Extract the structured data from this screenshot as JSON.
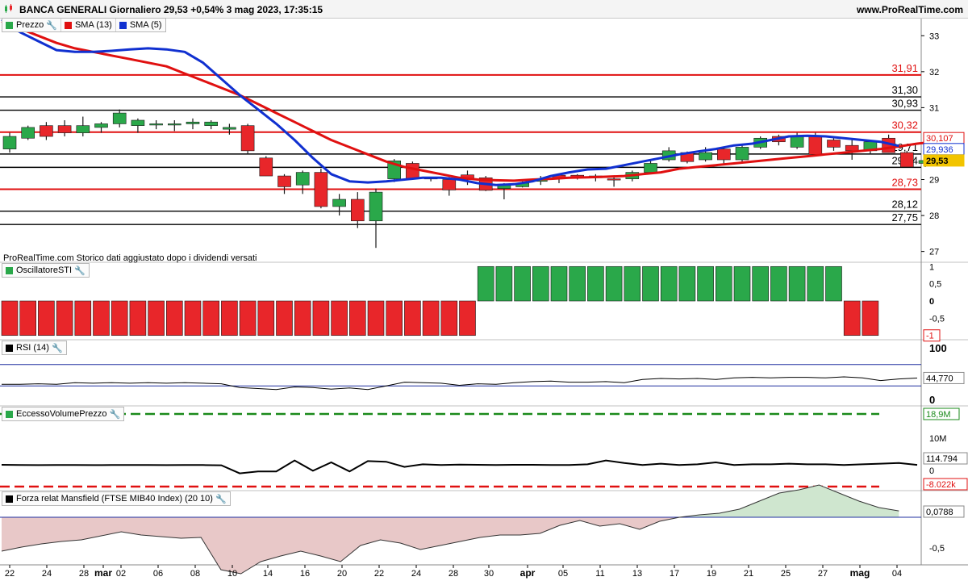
{
  "header": {
    "title": "BANCA GENERALI Giornaliero 29,53 +0,54% 3 mag 2023, 17:35:15",
    "site": "www.ProRealTime.com"
  },
  "note": "ProRealTime.com Storico dati aggiustato dopo i dividendi versati",
  "legends": {
    "price": [
      {
        "label": "Prezzo",
        "color": "#2aa84a",
        "icon": "candles-icon"
      },
      {
        "label": "SMA (13)",
        "color": "#e01010",
        "icon": "sma-icon"
      },
      {
        "label": "SMA (5)",
        "color": "#1030d0",
        "icon": "sma-icon"
      }
    ],
    "sti": "OscillatoreSTI",
    "rsi": "RSI (14)",
    "volume": "EccessoVolumePrezzo",
    "mansfield": "Forza relat Mansfield (FTSE MIB40 Index) (20 10)"
  },
  "colors": {
    "up": "#2aa84a",
    "down": "#e8262a",
    "sma13": "#e01010",
    "sma5": "#1030d0",
    "lastPrice": "#f2c400"
  },
  "chart_data": [
    {
      "type": "candlestick",
      "title": "BANCA GENERALI Giornaliero",
      "x_ticks": [
        "22",
        "24",
        "28",
        "mar",
        "02",
        "06",
        "08",
        "10",
        "14",
        "16",
        "20",
        "22",
        "24",
        "28",
        "30",
        "apr",
        "05",
        "11",
        "13",
        "17",
        "19",
        "21",
        "25",
        "27",
        "mag",
        "04"
      ],
      "y_ticks": [
        "27",
        "28",
        "29",
        "30",
        "31",
        "32",
        "33"
      ],
      "ylim": [
        26.7,
        33.5
      ],
      "ohlc": [
        [
          29.85,
          30.3,
          29.75,
          30.2
        ],
        [
          30.15,
          30.5,
          30.1,
          30.45
        ],
        [
          30.5,
          30.6,
          30.1,
          30.2
        ],
        [
          30.5,
          30.65,
          30.2,
          30.3
        ],
        [
          30.3,
          30.75,
          30.2,
          30.5
        ],
        [
          30.45,
          30.6,
          30.3,
          30.55
        ],
        [
          30.55,
          30.95,
          30.45,
          30.85
        ],
        [
          30.5,
          30.7,
          30.3,
          30.65
        ],
        [
          30.55,
          30.65,
          30.4,
          30.55
        ],
        [
          30.55,
          30.65,
          30.35,
          30.55
        ],
        [
          30.55,
          30.7,
          30.4,
          30.6
        ],
        [
          30.5,
          30.65,
          30.4,
          30.6
        ],
        [
          30.4,
          30.55,
          30.25,
          30.45
        ],
        [
          30.5,
          30.55,
          29.7,
          29.8
        ],
        [
          29.6,
          29.65,
          29.1,
          29.1
        ],
        [
          29.1,
          29.15,
          28.6,
          28.8
        ],
        [
          28.85,
          29.25,
          28.6,
          29.2
        ],
        [
          29.2,
          29.3,
          28.2,
          28.25
        ],
        [
          28.25,
          28.6,
          28.0,
          28.45
        ],
        [
          28.45,
          28.65,
          27.65,
          27.85
        ],
        [
          27.85,
          28.75,
          27.1,
          28.65
        ],
        [
          29.02,
          29.57,
          28.93,
          29.52
        ],
        [
          29.45,
          29.5,
          29.0,
          29.02
        ],
        [
          29.02,
          29.07,
          28.95,
          29.05
        ],
        [
          29.0,
          29.07,
          28.55,
          28.71
        ],
        [
          29.13,
          29.25,
          28.85,
          29.0
        ],
        [
          29.05,
          29.1,
          28.68,
          28.7
        ],
        [
          28.75,
          28.9,
          28.45,
          28.85
        ],
        [
          28.8,
          28.95,
          28.78,
          28.9
        ],
        [
          28.95,
          29.1,
          28.85,
          29.0
        ],
        [
          29.12,
          29.15,
          28.9,
          29.05
        ],
        [
          29.12,
          29.15,
          29.0,
          29.05
        ],
        [
          29.1,
          29.15,
          28.95,
          29.05
        ],
        [
          29.02,
          29.07,
          28.8,
          29.0
        ],
        [
          29.02,
          29.25,
          28.95,
          29.2
        ],
        [
          29.2,
          29.55,
          29.15,
          29.45
        ],
        [
          29.55,
          29.9,
          29.5,
          29.8
        ],
        [
          29.75,
          29.78,
          29.45,
          29.5
        ],
        [
          29.55,
          29.9,
          29.5,
          29.75
        ],
        [
          29.85,
          29.9,
          29.4,
          29.55
        ],
        [
          29.55,
          29.95,
          29.5,
          29.9
        ],
        [
          29.9,
          30.2,
          29.85,
          30.15
        ],
        [
          30.2,
          30.25,
          29.95,
          30.05
        ],
        [
          29.9,
          30.3,
          29.85,
          30.2
        ],
        [
          30.2,
          30.3,
          29.65,
          29.7
        ],
        [
          30.1,
          30.2,
          29.8,
          29.9
        ],
        [
          29.95,
          30.1,
          29.55,
          29.8
        ],
        [
          29.8,
          30.1,
          29.7,
          30.05
        ],
        [
          30.15,
          30.25,
          29.75,
          29.75
        ],
        [
          29.75,
          29.8,
          29.4,
          29.35
        ],
        [
          29.45,
          29.6,
          29.35,
          29.53
        ]
      ],
      "series": [
        {
          "name": "SMA (13)",
          "values": [
            33.4,
            33.2,
            33.0,
            32.8,
            32.65,
            32.55,
            32.45,
            32.35,
            32.25,
            32.15,
            31.95,
            31.75,
            31.55,
            31.35,
            31.1,
            30.85,
            30.6,
            30.35,
            30.1,
            29.9,
            29.7,
            29.5,
            29.35,
            29.25,
            29.15,
            29.05,
            29.0,
            28.98,
            28.97,
            29.0,
            29.02,
            29.05,
            29.06,
            29.08,
            29.1,
            29.15,
            29.2,
            29.3,
            29.35,
            29.4,
            29.45,
            29.5,
            29.55,
            29.6,
            29.65,
            29.7,
            29.75,
            29.8,
            29.85,
            29.92,
            30.0,
            30.05,
            30.107
          ]
        },
        {
          "name": "SMA (5)",
          "values": [
            33.45,
            33.1,
            32.85,
            32.6,
            32.55,
            32.55,
            32.58,
            32.62,
            32.65,
            32.62,
            32.55,
            32.25,
            31.8,
            31.35,
            30.95,
            30.55,
            30.1,
            29.6,
            29.15,
            28.95,
            28.92,
            28.95,
            29.0,
            29.05,
            29.05,
            29.0,
            28.9,
            28.85,
            28.87,
            28.95,
            29.1,
            29.2,
            29.28,
            29.3,
            29.4,
            29.5,
            29.6,
            29.7,
            29.78,
            29.85,
            29.95,
            30.0,
            30.1,
            30.2,
            30.22,
            30.2,
            30.15,
            30.1,
            30.05,
            29.936
          ]
        }
      ],
      "levels": [
        {
          "value": "31,91",
          "y": 31.91,
          "color": "red"
        },
        {
          "value": "31,30",
          "y": 31.3,
          "color": "black"
        },
        {
          "value": "30,93",
          "y": 30.93,
          "color": "black"
        },
        {
          "value": "30,32",
          "y": 30.32,
          "color": "red"
        },
        {
          "value": "29,71",
          "y": 29.71,
          "color": "black"
        },
        {
          "value": "29,34",
          "y": 29.34,
          "color": "black"
        },
        {
          "value": "28,73",
          "y": 28.73,
          "color": "red"
        },
        {
          "value": "28,12",
          "y": 28.12,
          "color": "black"
        },
        {
          "value": "27,75",
          "y": 27.75,
          "color": "black"
        }
      ],
      "last_labels": {
        "sma13": "30,107",
        "sma5": "29,936",
        "price": "29,53"
      }
    },
    {
      "type": "bar",
      "title": "OscillatoreSTI",
      "y_ticks": [
        "1",
        "0,5",
        "0",
        "-0,5",
        "-1"
      ],
      "ylim": [
        -1.1,
        1.1
      ],
      "values": [
        -1,
        -1,
        -1,
        -1,
        -1,
        -1,
        -1,
        -1,
        -1,
        -1,
        -1,
        -1,
        -1,
        -1,
        -1,
        -1,
        -1,
        -1,
        -1,
        -1,
        -1,
        -1,
        -1,
        -1,
        -1,
        -1,
        1,
        1,
        1,
        1,
        1,
        1,
        1,
        1,
        1,
        1,
        1,
        1,
        1,
        1,
        1,
        1,
        1,
        1,
        1,
        1,
        -1,
        -1
      ]
    },
    {
      "type": "line",
      "title": "RSI (14)",
      "y_ticks": [
        "100",
        "0"
      ],
      "ylim": [
        0,
        100
      ],
      "bands": [
        70,
        30
      ],
      "last_label": "44,770",
      "values": [
        33,
        33,
        34,
        33,
        36,
        35,
        36,
        35,
        36,
        35,
        36,
        35,
        34,
        27,
        25,
        23,
        28,
        27,
        24,
        26,
        23,
        30,
        37,
        36,
        35,
        31,
        34,
        33,
        36,
        38,
        39,
        37,
        37,
        38,
        36,
        42,
        44,
        43,
        44,
        42,
        45,
        46,
        45,
        46,
        46,
        45,
        47,
        45,
        40,
        43,
        44.77
      ]
    },
    {
      "type": "line",
      "title": "EccessoVolumePrezzo",
      "y_ticks": [
        "10M"
      ],
      "upper_label": "18,9M",
      "last_label": "114.794",
      "zero_label": "0",
      "lower_label": "-8.022k",
      "values": [
        0.12,
        0.1,
        0.08,
        0.09,
        0.1,
        0.08,
        0.09,
        0.1,
        0.09,
        0.08,
        0.1,
        0.09,
        0.05,
        -1.2,
        -0.9,
        -0.9,
        0.8,
        -0.8,
        0.5,
        -0.9,
        0.7,
        0.6,
        -0.2,
        0.2,
        0.1,
        0.15,
        0.12,
        0.1,
        0.13,
        0.12,
        0.1,
        0.1,
        0.2,
        0.8,
        0.4,
        0.1,
        0.3,
        0.1,
        0.2,
        0.5,
        0.1,
        0.2,
        0.2,
        0.3,
        0.2,
        0.2,
        0.1,
        0.2,
        0.3,
        0.4,
        0.1148
      ]
    },
    {
      "type": "area",
      "title": "Forza relat Mansfield (FTSE MIB40 Index) (20 10)",
      "y_ticks": [
        "-0,5"
      ],
      "last_label": "0,0788",
      "values": [
        -0.42,
        -0.37,
        -0.33,
        -0.3,
        -0.28,
        -0.23,
        -0.18,
        -0.22,
        -0.24,
        -0.26,
        -0.25,
        -0.65,
        -0.7,
        -0.55,
        -0.48,
        -0.42,
        -0.48,
        -0.55,
        -0.35,
        -0.28,
        -0.32,
        -0.4,
        -0.35,
        -0.3,
        -0.25,
        -0.22,
        -0.22,
        -0.2,
        -0.1,
        -0.04,
        -0.11,
        -0.08,
        -0.15,
        -0.05,
        0.0,
        0.03,
        0.05,
        0.1,
        0.2,
        0.3,
        0.34,
        0.4,
        0.3,
        0.2,
        0.12,
        0.0788
      ]
    }
  ]
}
